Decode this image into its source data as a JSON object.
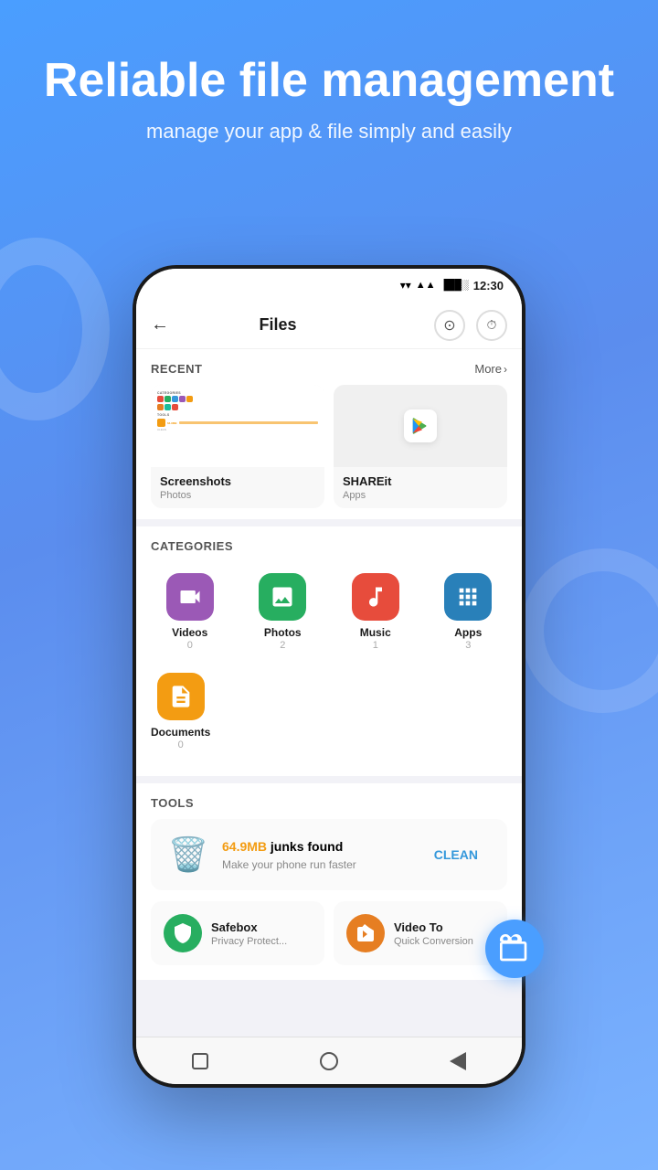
{
  "header": {
    "title": "Reliable file management",
    "subtitle": "manage your app & file simply and easily"
  },
  "status_bar": {
    "time": "12:30",
    "wifi": "▾",
    "signal": "▲▲",
    "battery": "🔋"
  },
  "top_bar": {
    "back_label": "←",
    "title": "Files",
    "download_action": "⊙",
    "history_action": "⏱"
  },
  "recent": {
    "section_label": "RECENT",
    "more_label": "More",
    "items": [
      {
        "name": "Screenshots",
        "type": "Photos"
      },
      {
        "name": "SHAREit",
        "type": "Apps"
      }
    ]
  },
  "categories": {
    "section_label": "CATEGORIES",
    "items": [
      {
        "name": "Videos",
        "count": "0",
        "icon": "📹",
        "color_class": "cat-videos"
      },
      {
        "name": "Photos",
        "count": "2",
        "icon": "🏔",
        "color_class": "cat-photos"
      },
      {
        "name": "Music",
        "count": "1",
        "icon": "🎵",
        "color_class": "cat-music"
      },
      {
        "name": "Apps",
        "count": "3",
        "icon": "⊞",
        "color_class": "cat-apps"
      },
      {
        "name": "Documents",
        "count": "0",
        "icon": "📄",
        "color_class": "cat-documents"
      }
    ]
  },
  "tools": {
    "section_label": "TOOLS",
    "junk": {
      "size": "64.9MB",
      "suffix": " junks found",
      "desc": "Make your phone run faster",
      "clean_label": "CLEAN"
    },
    "items": [
      {
        "name": "Safebox",
        "desc": "Privacy Protect...",
        "color_class": "tool-safebox"
      },
      {
        "name": "Video To",
        "desc": "Quick Conversion",
        "color_class": "tool-video"
      }
    ]
  },
  "nav": {
    "square_label": "□",
    "circle_label": "○",
    "back_label": "◁"
  },
  "colors": {
    "accent": "#4a9eff",
    "junk_orange": "#f39c12",
    "clean_blue": "#3498db"
  }
}
